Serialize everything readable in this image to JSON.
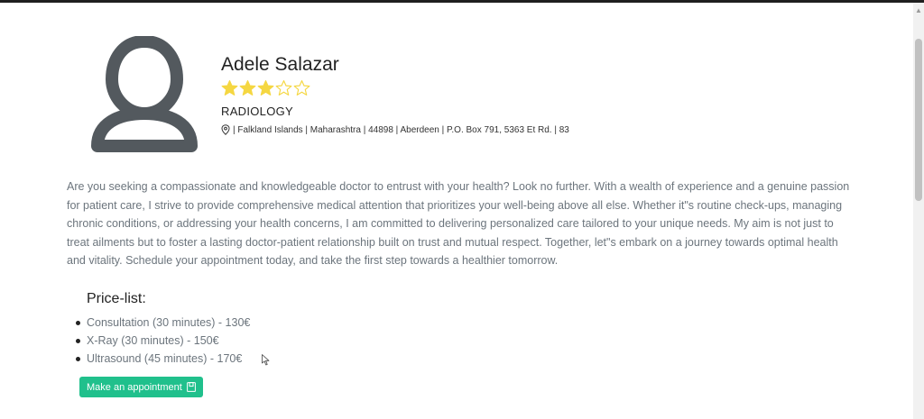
{
  "doctor": {
    "name": "Adele Salazar",
    "rating": 3,
    "rating_max": 5,
    "specialty": "RADIOLOGY",
    "address": "| Falkland Islands | Maharashtra | 44898 | Aberdeen | P.O. Box 791, 5363 Et Rd. | 83",
    "bio": "Are you seeking a compassionate and knowledgeable doctor to entrust with your health? Look no further. With a wealth of experience and a genuine passion for patient care, I strive to provide comprehensive medical attention that prioritizes your well-being above all else. Whether it\"s routine check-ups, managing chronic conditions, or addressing your health concerns, I am committed to delivering personalized care tailored to your unique needs. My aim is not just to treat ailments but to foster a lasting doctor-patient relationship built on trust and mutual respect. Together, let\"s embark on a journey towards optimal health and vitality. Schedule your appointment today, and take the first step towards a healthier tomorrow."
  },
  "price_list": {
    "title": "Price-list:",
    "items": [
      "Consultation (30 minutes) - 130€",
      "X-Ray (30 minutes) - 150€",
      "Ultrasound (45 minutes) - 170€"
    ]
  },
  "appointment_button": {
    "label": "Make an appointment",
    "icon": "calendar-icon"
  },
  "icons": {
    "avatar": "user-avatar-icon",
    "address": "map-pin-icon"
  },
  "colors": {
    "star_filled": "#f5d742",
    "star_outline": "#f5d742",
    "avatar": "#53595e",
    "button": "#20c08c",
    "bio_text": "#6c757d"
  }
}
